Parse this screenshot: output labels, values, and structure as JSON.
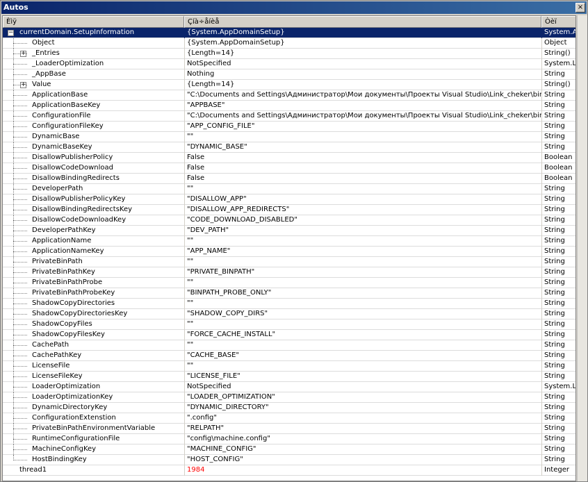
{
  "window": {
    "title": "Autos",
    "close_glyph": "×"
  },
  "columns": {
    "name": "Èìÿ",
    "value": "Çíà÷åíèå",
    "type": "Òèï"
  },
  "rows": [
    {
      "name": "currentDomain.SetupInformation",
      "value": "{System.AppDomainSetup}",
      "type": "System.Ap",
      "level": 0,
      "expander": "−",
      "selected": true
    },
    {
      "name": "Object",
      "value": "{System.AppDomainSetup}",
      "type": "Object",
      "level": 1
    },
    {
      "name": "_Entries",
      "value": "{Length=14}",
      "type": "String()",
      "level": 1,
      "expander": "+"
    },
    {
      "name": "_LoaderOptimization",
      "value": "NotSpecified",
      "type": "System.Lo",
      "level": 1
    },
    {
      "name": "_AppBase",
      "value": "Nothing",
      "type": "String",
      "level": 1
    },
    {
      "name": "Value",
      "value": "{Length=14}",
      "type": "String()",
      "level": 1,
      "expander": "+"
    },
    {
      "name": "ApplicationBase",
      "value": "\"C:\\Documents and Settings\\Администратор\\Мои документы\\Проекты Visual Studio\\Link_cheker\\bin\\\"",
      "type": "String",
      "level": 1
    },
    {
      "name": "ApplicationBaseKey",
      "value": "\"APPBASE\"",
      "type": "String",
      "level": 1
    },
    {
      "name": "ConfigurationFile",
      "value": "\"C:\\Documents and Settings\\Администратор\\Мои документы\\Проекты Visual Studio\\Link_cheker\\bin\\Lin",
      "type": "String",
      "level": 1
    },
    {
      "name": "ConfigurationFileKey",
      "value": "\"APP_CONFIG_FILE\"",
      "type": "String",
      "level": 1
    },
    {
      "name": "DynamicBase",
      "value": "\"\"",
      "type": "String",
      "level": 1
    },
    {
      "name": "DynamicBaseKey",
      "value": "\"DYNAMIC_BASE\"",
      "type": "String",
      "level": 1
    },
    {
      "name": "DisallowPublisherPolicy",
      "value": "False",
      "type": "Boolean",
      "level": 1
    },
    {
      "name": "DisallowCodeDownload",
      "value": "False",
      "type": "Boolean",
      "level": 1
    },
    {
      "name": "DisallowBindingRedirects",
      "value": "False",
      "type": "Boolean",
      "level": 1
    },
    {
      "name": "DeveloperPath",
      "value": "\"\"",
      "type": "String",
      "level": 1
    },
    {
      "name": "DisallowPublisherPolicyKey",
      "value": "\"DISALLOW_APP\"",
      "type": "String",
      "level": 1
    },
    {
      "name": "DisallowBindingRedirectsKey",
      "value": "\"DISALLOW_APP_REDIRECTS\"",
      "type": "String",
      "level": 1
    },
    {
      "name": "DisallowCodeDownloadKey",
      "value": "\"CODE_DOWNLOAD_DISABLED\"",
      "type": "String",
      "level": 1
    },
    {
      "name": "DeveloperPathKey",
      "value": "\"DEV_PATH\"",
      "type": "String",
      "level": 1
    },
    {
      "name": "ApplicationName",
      "value": "\"\"",
      "type": "String",
      "level": 1
    },
    {
      "name": "ApplicationNameKey",
      "value": "\"APP_NAME\"",
      "type": "String",
      "level": 1
    },
    {
      "name": "PrivateBinPath",
      "value": "\"\"",
      "type": "String",
      "level": 1
    },
    {
      "name": "PrivateBinPathKey",
      "value": "\"PRIVATE_BINPATH\"",
      "type": "String",
      "level": 1
    },
    {
      "name": "PrivateBinPathProbe",
      "value": "\"\"",
      "type": "String",
      "level": 1
    },
    {
      "name": "PrivateBinPathProbeKey",
      "value": "\"BINPATH_PROBE_ONLY\"",
      "type": "String",
      "level": 1
    },
    {
      "name": "ShadowCopyDirectories",
      "value": "\"\"",
      "type": "String",
      "level": 1
    },
    {
      "name": "ShadowCopyDirectoriesKey",
      "value": "\"SHADOW_COPY_DIRS\"",
      "type": "String",
      "level": 1
    },
    {
      "name": "ShadowCopyFiles",
      "value": "\"\"",
      "type": "String",
      "level": 1
    },
    {
      "name": "ShadowCopyFilesKey",
      "value": "\"FORCE_CACHE_INSTALL\"",
      "type": "String",
      "level": 1
    },
    {
      "name": "CachePath",
      "value": "\"\"",
      "type": "String",
      "level": 1
    },
    {
      "name": "CachePathKey",
      "value": "\"CACHE_BASE\"",
      "type": "String",
      "level": 1
    },
    {
      "name": "LicenseFile",
      "value": "\"\"",
      "type": "String",
      "level": 1
    },
    {
      "name": "LicenseFileKey",
      "value": "\"LICENSE_FILE\"",
      "type": "String",
      "level": 1
    },
    {
      "name": "LoaderOptimization",
      "value": "NotSpecified",
      "type": "System.Lo",
      "level": 1
    },
    {
      "name": "LoaderOptimizationKey",
      "value": "\"LOADER_OPTIMIZATION\"",
      "type": "String",
      "level": 1
    },
    {
      "name": "DynamicDirectoryKey",
      "value": "\"DYNAMIC_DIRECTORY\"",
      "type": "String",
      "level": 1
    },
    {
      "name": "ConfigurationExtenstion",
      "value": "\".config\"",
      "type": "String",
      "level": 1
    },
    {
      "name": "PrivateBinPathEnvironmentVariable",
      "value": "\"RELPATH\"",
      "type": "String",
      "level": 1
    },
    {
      "name": "RuntimeConfigurationFile",
      "value": "\"config\\machine.config\"",
      "type": "String",
      "level": 1
    },
    {
      "name": "MachineConfigKey",
      "value": "\"MACHINE_CONFIG\"",
      "type": "String",
      "level": 1
    },
    {
      "name": "HostBindingKey",
      "value": "\"HOST_CONFIG\"",
      "type": "String",
      "level": 1,
      "last": true
    },
    {
      "name": "thread1",
      "value": "1984",
      "type": "Integer",
      "level": 0,
      "changed": true
    }
  ]
}
